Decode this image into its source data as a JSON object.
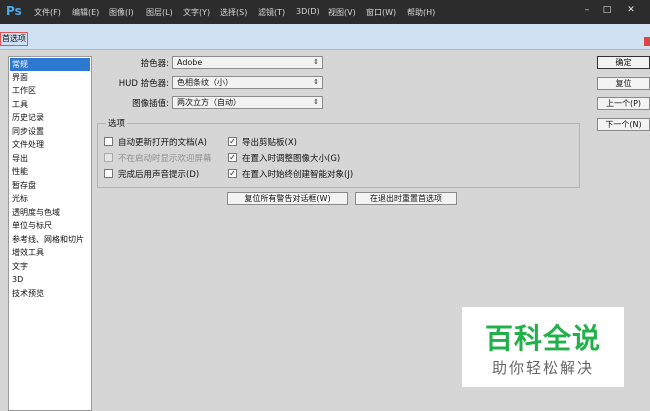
{
  "app": {
    "logo": "Ps",
    "menu": [
      "文件(F)",
      "编辑(E)",
      "图像(I)",
      "图层(L)",
      "文字(Y)",
      "选择(S)",
      "滤镜(T)",
      "3D(D)",
      "视图(V)",
      "窗口(W)",
      "帮助(H)"
    ],
    "window_controls": [
      "–",
      "□",
      "✕"
    ]
  },
  "dialog": {
    "title": "首选项",
    "categories": [
      "常规",
      "界面",
      "工作区",
      "工具",
      "历史记录",
      "同步设置",
      "文件处理",
      "导出",
      "性能",
      "暂存盘",
      "光标",
      "透明度与色域",
      "单位与标尺",
      "参考线、网格和切片",
      "增效工具",
      "文字",
      "3D",
      "技术预览"
    ],
    "selected_category": "常规",
    "fields": {
      "color_picker": {
        "label": "拾色器:",
        "value": "Adobe"
      },
      "hud_color_picker": {
        "label": "HUD 拾色器:",
        "value": "色相条纹（小）"
      },
      "image_interpolation": {
        "label": "图像插值:",
        "value": "两次立方（自动）"
      }
    },
    "options": {
      "title": "选项",
      "checkboxes": [
        {
          "label": "自动更新打开的文档(A)",
          "checked": false,
          "disabled": false
        },
        {
          "label": "不在启动时显示欢迎屏幕",
          "checked": false,
          "disabled": true
        },
        {
          "label": "完成后用声音提示(D)",
          "checked": false,
          "disabled": false
        },
        {
          "label": "导出剪贴板(X)",
          "checked": true,
          "disabled": false
        },
        {
          "label": "在置入时调整图像大小(G)",
          "checked": true,
          "disabled": false
        },
        {
          "label": "在置入时始终创建智能对象(J)",
          "checked": true,
          "disabled": false
        }
      ],
      "check_mark": "✓"
    },
    "reset_buttons": {
      "reset_warnings": "复位所有警告对话框(W)",
      "reset_on_quit": "在退出时重置首选项"
    },
    "side_buttons": {
      "ok": "确定",
      "reset": "复位",
      "prev": "上一个(P)",
      "next": "下一个(N)"
    }
  },
  "watermark": {
    "main": "百科全说",
    "sub": "助你轻松解决"
  }
}
